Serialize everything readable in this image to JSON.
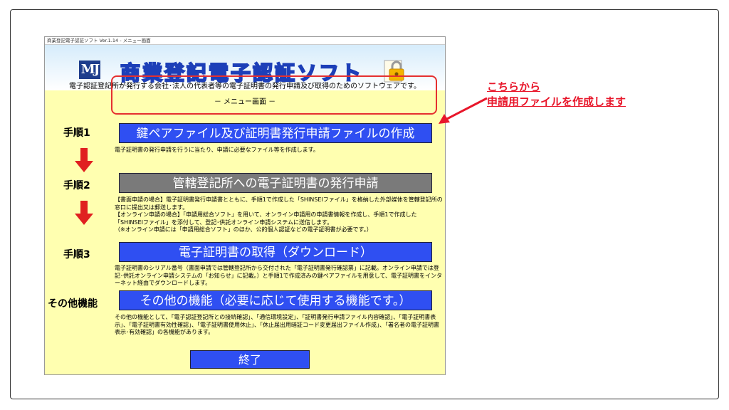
{
  "window": {
    "title": "商業登記電子認証ソフト Ver.1.14 - メニュー画面"
  },
  "banner": {
    "logo_text": "MJ",
    "app_name": "商業登記電子認証ソフト",
    "description": "電子認証登記所が発行する会社･法人の代表者等の電子証明書の発行申請及び取得のためのソフトウェアです。"
  },
  "menu": {
    "header": "－ メニュー画面 －",
    "steps": [
      {
        "label": "手順1",
        "button": "鍵ペアファイル及び証明書発行申請ファイルの作成",
        "description": "電子証明書の発行申請を行うに当たり、申請に必要なファイル等を作成します。"
      },
      {
        "label": "手順2",
        "button": "管轄登記所への電子証明書の発行申請",
        "description": "【書面申請の場合】電子証明書発行申請書とともに、手順1で作成した「SHINSEIファイル」を格納した外部媒体を管轄登記所の窓口に提出又は郵送します。\n【オンライン申請の場合】「申請用総合ソフト」を用いて、オンライン申請用の申請書情報を作成し、手順1で作成した「SHINSEIファイル」を添付して、登記･供託オンライン申請システムに送信します。\n（※オンライン申請には「申請用総合ソフト」のほか、公的個人認証などの電子証明書が必要です。）"
      },
      {
        "label": "手順3",
        "button": "電子証明書の取得（ダウンロード）",
        "description": "電子証明書のシリアル番号（書面申請では管轄登記所から交付された「電子証明書発行確認票」に記載。オンライン申請では登記･供託オンライン申請システムの「お知らせ」に記載。）と手順1で作成済みの鍵ペアファイルを用意して、電子証明書をインターネット経由でダウンロードします。"
      },
      {
        "label": "その他機能",
        "button": "その他の機能（必要に応じて使用する機能です。）",
        "description": "その他の機能として、「電子認証登記所との接続確認」、「通信環境設定」、「証明書発行申請ファイル内容確認」、「電子証明書表示」、「電子証明書有効性確認」、「電子証明書使用休止」、「休止届出用暗証コード変更届出ファイル作成」、「署名者の電子証明書表示･有効確認」の各機能があります。"
      }
    ],
    "exit_button": "終了"
  },
  "annotation": {
    "line1": "こちらから",
    "line2": "申請用ファイルを作成します"
  },
  "colors": {
    "app_background": "#ffffb0",
    "button_blue": "#2f4ff2",
    "button_gray": "#7a7a7a",
    "arrow_red": "#e02020",
    "callout_red": "#e53030"
  }
}
